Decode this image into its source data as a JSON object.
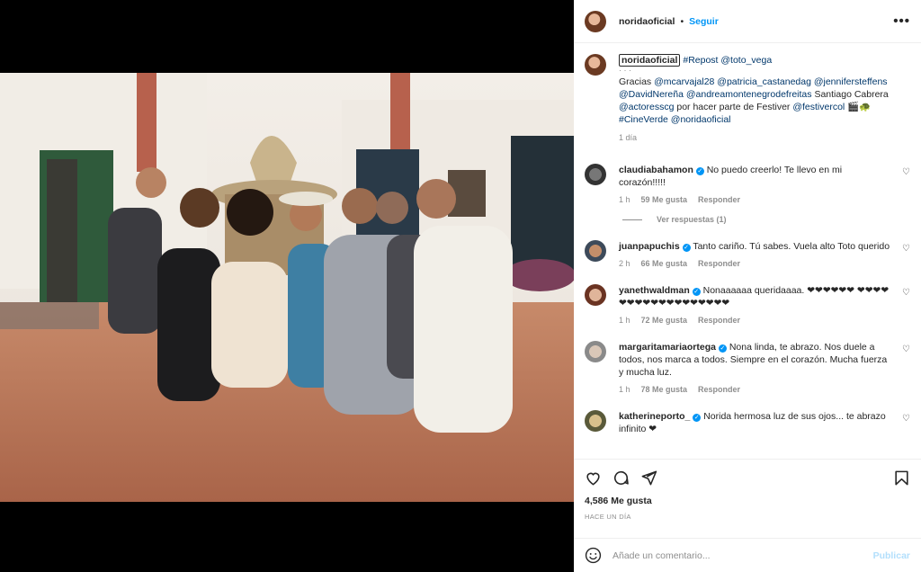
{
  "post": {
    "username": "noridaoficial",
    "separator": "•",
    "follow_label": "Seguir",
    "more_icon": "more-horizontal-icon"
  },
  "caption": {
    "username": "noridaoficial",
    "repost_tag": "#Repost",
    "repost_user": "@toto_vega",
    "dots": "· · ·",
    "thanks": "Gracias",
    "mentions_line1": "@mcarvajal28 @patricia_castanedag @jennifersteffens",
    "mentions_line2a": "@DavidNereña @andreamontenegrodefreitas",
    "plain_name": "Santiago Cabrera",
    "mention_actores": "@actoresscg",
    "text_middle": "por hacer parte de Festiver",
    "mention_festiver": "@festivercol",
    "emojis": "🎬🐢",
    "hashtag": "#CineVerde",
    "mention_self": "@noridaoficial",
    "time": "1 día"
  },
  "comments": [
    {
      "user": "claudiabahamon",
      "verified": true,
      "text": "No puedo creerlo! Te llevo en mi corazón!!!!!",
      "time": "1 h",
      "likes": "59 Me gusta",
      "reply": "Responder",
      "replies": "Ver respuestas (1)"
    },
    {
      "user": "juanpapuchis",
      "verified": true,
      "text": "Tanto cariño. Tú sabes. Vuela alto Toto querido",
      "time": "2 h",
      "likes": "66 Me gusta",
      "reply": "Responder"
    },
    {
      "user": "yanethwaldman",
      "verified": true,
      "text": "Nonaaaaaa queridaaaa. ❤❤❤❤❤❤ ❤❤❤❤❤❤❤❤❤❤❤❤❤❤❤❤❤❤",
      "time": "1 h",
      "likes": "72 Me gusta",
      "reply": "Responder"
    },
    {
      "user": "margaritamariaortega",
      "verified": true,
      "text": "Nona linda, te abrazo. Nos duele a todos, nos marca a todos. Siempre en el corazón. Mucha fuerza y mucha luz.",
      "time": "1 h",
      "likes": "78 Me gusta",
      "reply": "Responder"
    },
    {
      "user": "katherineporto_",
      "verified": true,
      "text": "Norida hermosa luz de sus ojos... te abrazo infinito ❤"
    }
  ],
  "actions": {
    "likes": "4,586 Me gusta",
    "ago": "HACE UN DÍA"
  },
  "add_comment": {
    "placeholder": "Añade un comentario...",
    "publish": "Publicar"
  },
  "colors": {
    "link": "#00376b",
    "accent": "#0095f6",
    "muted": "#8e8e8e"
  }
}
